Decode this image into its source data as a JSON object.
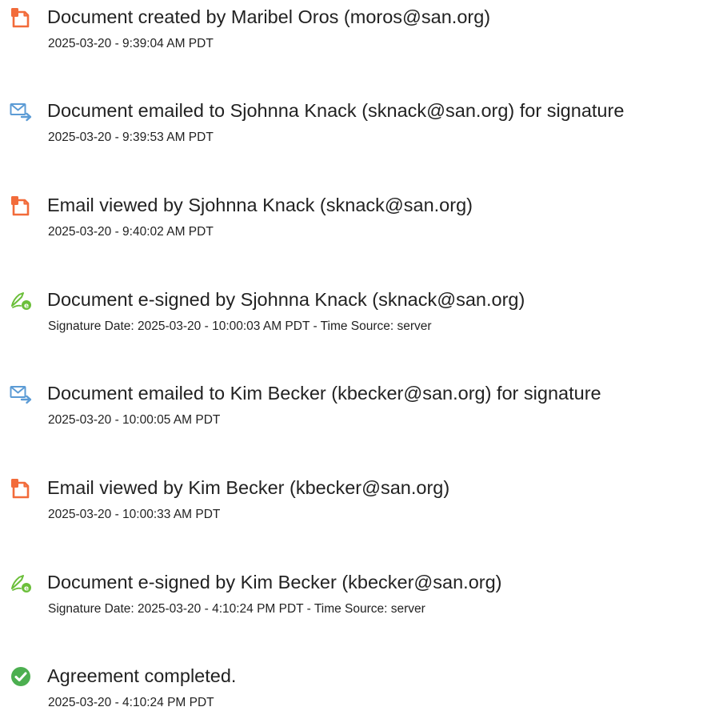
{
  "audit_log": {
    "events": [
      {
        "icon": "document-created-icon",
        "title": "Document created by Maribel Oros (moros@san.org)",
        "stamp": "2025-03-20 - 9:39:04 AM PDT"
      },
      {
        "icon": "email-sent-icon",
        "title": "Document emailed to Sjohnna Knack (sknack@san.org) for signature",
        "stamp": "2025-03-20 - 9:39:53 AM PDT"
      },
      {
        "icon": "email-viewed-icon",
        "title": "Email viewed by Sjohnna Knack (sknack@san.org)",
        "stamp": "2025-03-20 - 9:40:02 AM PDT"
      },
      {
        "icon": "e-signature-icon",
        "title": "Document e-signed by Sjohnna Knack (sknack@san.org)",
        "stamp": "Signature Date: 2025-03-20 - 10:00:03 AM PDT - Time Source: server"
      },
      {
        "icon": "email-sent-icon",
        "title": "Document emailed to Kim Becker (kbecker@san.org) for signature",
        "stamp": "2025-03-20 - 10:00:05 AM PDT"
      },
      {
        "icon": "email-viewed-icon",
        "title": "Email viewed by Kim Becker (kbecker@san.org)",
        "stamp": "2025-03-20 - 10:00:33 AM PDT"
      },
      {
        "icon": "e-signature-icon",
        "title": "Document e-signed by Kim Becker (kbecker@san.org)",
        "stamp": "Signature Date: 2025-03-20 - 4:10:24 PM PDT - Time Source: server"
      },
      {
        "icon": "completed-check-icon",
        "title": "Agreement completed.",
        "stamp": "2025-03-20 - 4:10:24 PM PDT"
      }
    ]
  },
  "colors": {
    "document_icon": "#F26B3A",
    "email_icon": "#5B9BD5",
    "signature_icon": "#6BBF3A",
    "completed_icon": "#4CAF50",
    "text": "#222222"
  }
}
